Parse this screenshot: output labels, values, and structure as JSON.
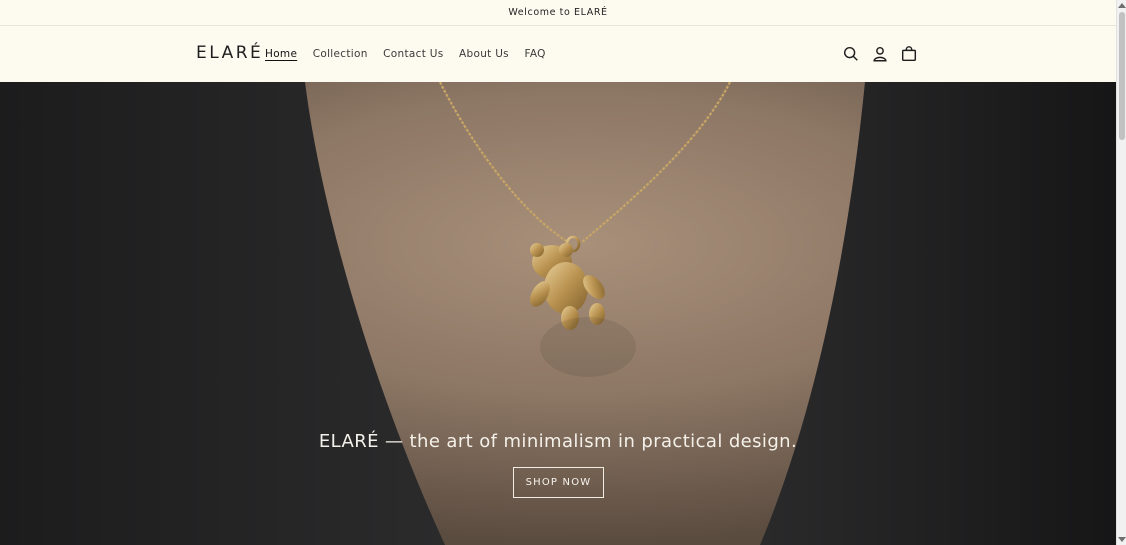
{
  "announcement": {
    "text": "Welcome to ELARÉ"
  },
  "header": {
    "logo": "ELARÉ",
    "nav": [
      {
        "label": "Home",
        "active": true
      },
      {
        "label": "Collection"
      },
      {
        "label": "Contact Us"
      },
      {
        "label": "About Us"
      },
      {
        "label": "FAQ"
      }
    ],
    "icons": [
      "search-icon",
      "account-icon",
      "cart-icon"
    ]
  },
  "hero": {
    "headline": "ELARÉ — the art of minimalism in practical design.",
    "button_label": "SHOP NOW",
    "image": "gold-bear-pendant-necklace"
  },
  "colors": {
    "background": "#fdfbf0",
    "text": "#1e1e1e",
    "hero_text": "#f4f1ea"
  }
}
